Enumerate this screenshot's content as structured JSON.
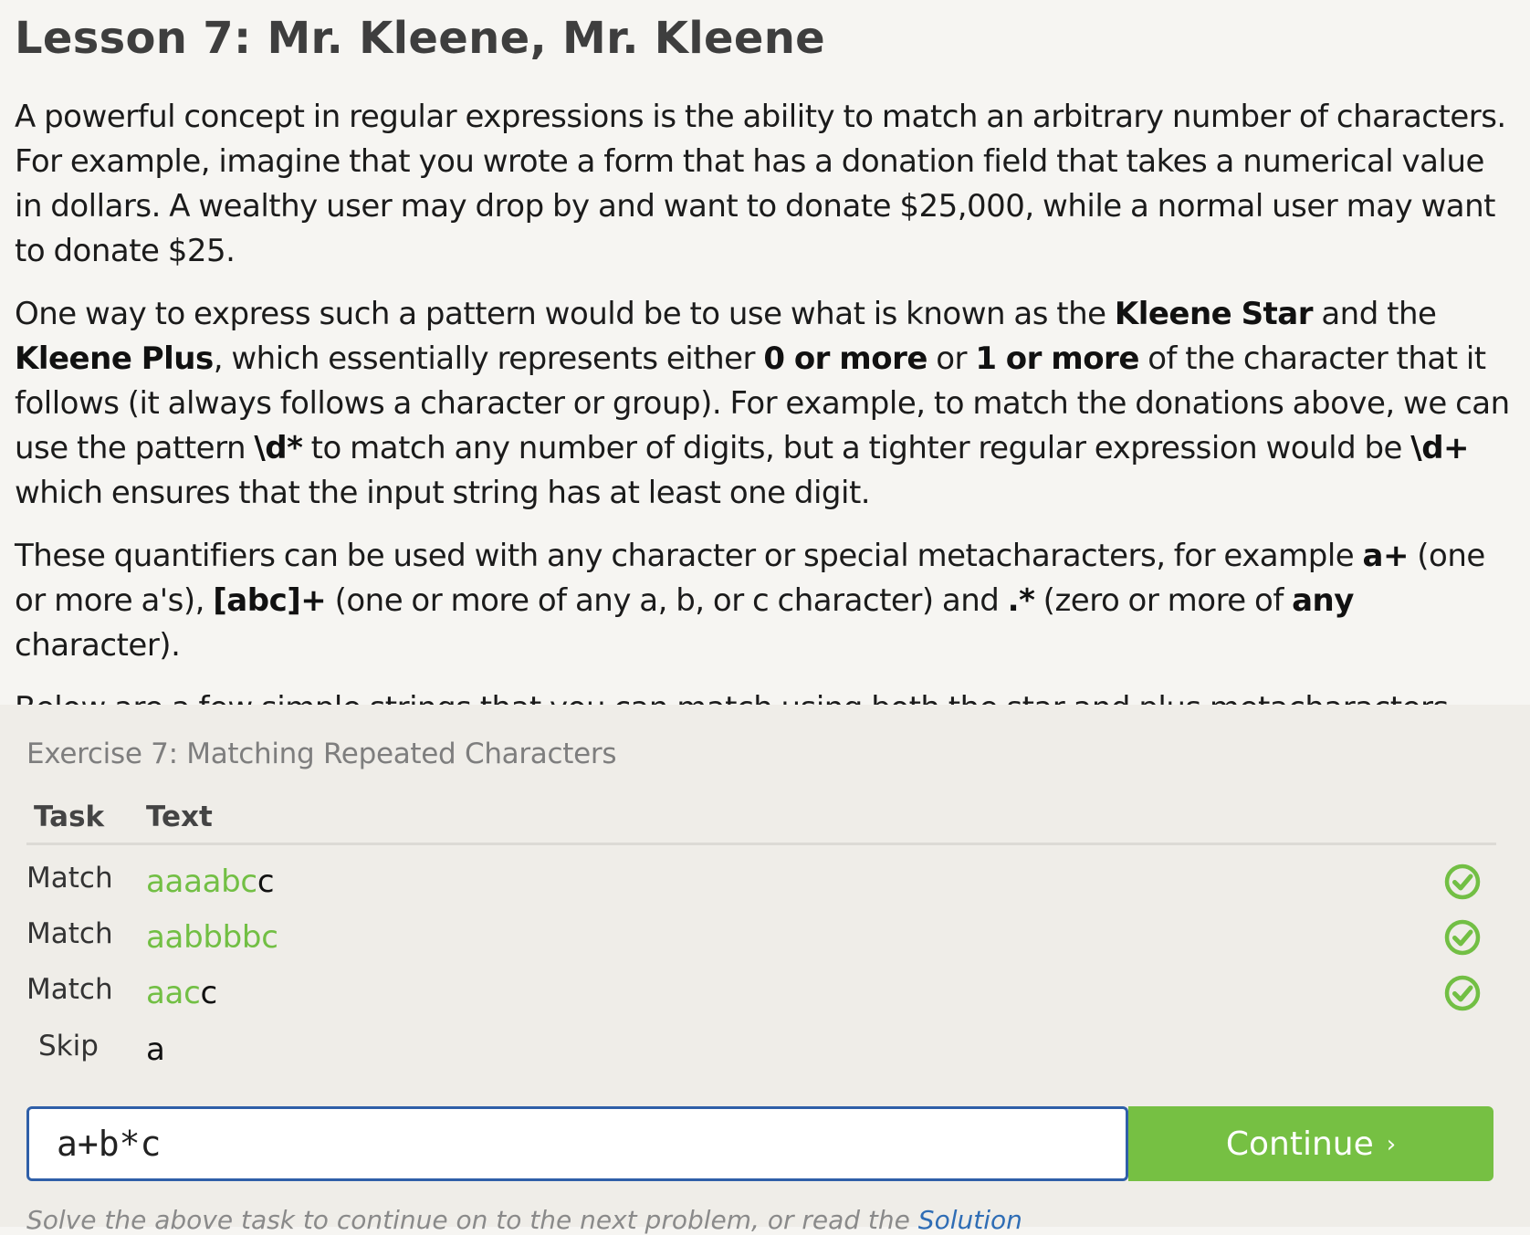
{
  "lesson": {
    "title": "Lesson 7: Mr. Kleene, Mr. Kleene",
    "p1": "A powerful concept in regular expressions is the ability to match an arbitrary number of characters. For example, imagine that you wrote a form that has a donation field that takes a numerical value in dollars. A wealthy user may drop by and want to donate $25,000, while a normal user may want to donate $25.",
    "p2": {
      "t1": "One way to express such a pattern would be to use what is known as the ",
      "b1": "Kleene Star",
      "t2": " and the ",
      "b2": "Kleene Plus",
      "t3": ", which essentially represents either ",
      "b3": "0 or more",
      "t4": " or ",
      "b4": "1 or more",
      "t5": " of the character that it follows (it always follows a character or group). For example, to match the donations above, we can use the pattern ",
      "b5": "\\d*",
      "t6": " to match any number of digits, but a tighter regular expression would be ",
      "b6": "\\d+",
      "t7": " which ensures that the input string has at least one digit."
    },
    "p3": {
      "t1": "These quantifiers can be used with any character or special metacharacters, for example ",
      "b1": "a+",
      "t2": " (one or more a's), ",
      "b2": "[abc]+",
      "t3": " (one or more of any a, b, or c character) and ",
      "b3": ".*",
      "t4": " (zero or more of ",
      "b4": "any",
      "t5": " character)."
    },
    "p4": "Below are a few simple strings that you can match using both the star and plus metacharacters."
  },
  "exercise": {
    "title": "Exercise 7: Matching Repeated Characters",
    "headers": {
      "task": "Task",
      "text": "Text"
    },
    "rows": [
      {
        "task": "Match",
        "matched": "aaaabc",
        "rest": "c",
        "status": "check-circle-icon"
      },
      {
        "task": "Match",
        "matched": "aabbbbc",
        "rest": "",
        "status": "check-circle-icon"
      },
      {
        "task": "Match",
        "matched": "aac",
        "rest": "c",
        "status": "check-circle-icon"
      },
      {
        "task": "Skip",
        "matched": "",
        "rest": "a",
        "status": ""
      }
    ],
    "input_value": "a+b*c",
    "continue_label": "Continue",
    "continue_chevron": "›",
    "footnote": "Solve the above task to continue on to the next problem, or read the ",
    "solution_link": "Solution"
  },
  "colors": {
    "page_bg": "#f6f5f2",
    "exercise_bg": "#efede8",
    "match_green": "#72bf44",
    "button_green": "#76c043",
    "input_border": "#2f5fa8",
    "link_blue": "#2f6db5"
  }
}
